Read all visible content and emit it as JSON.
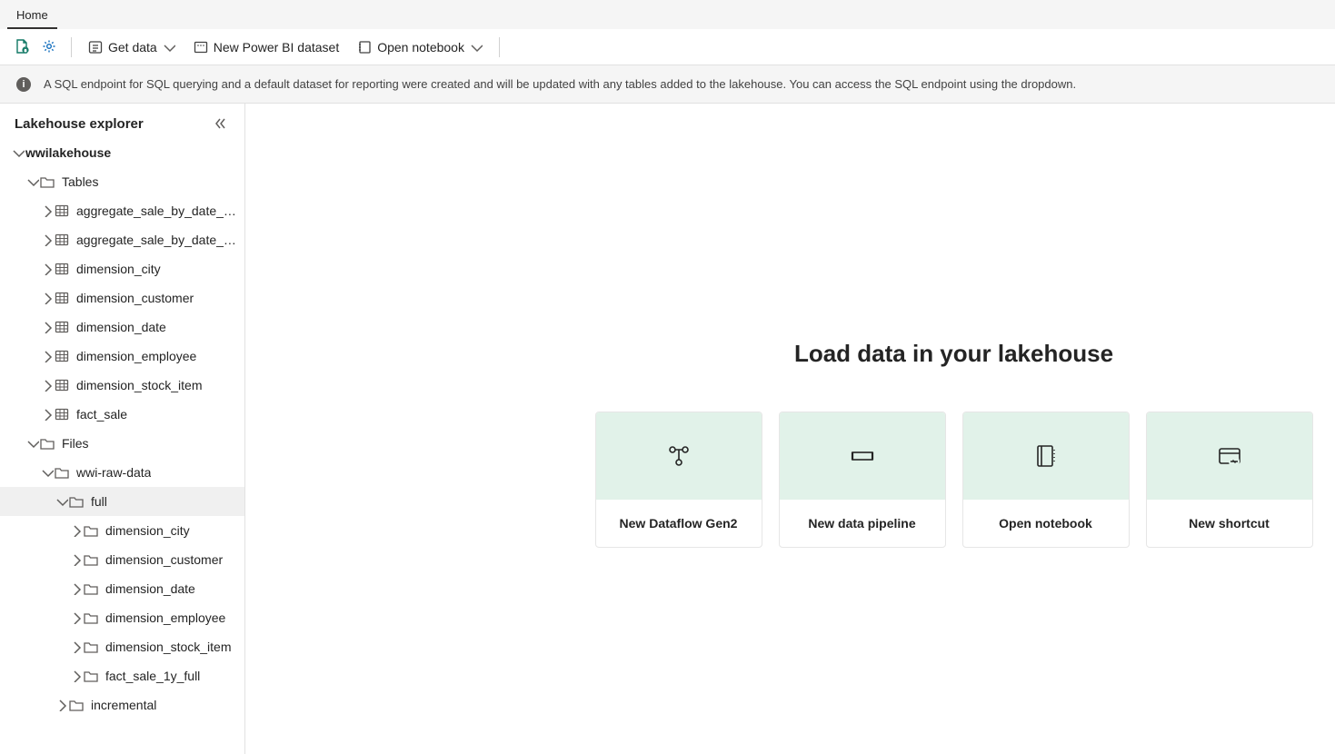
{
  "tabs": {
    "home": "Home"
  },
  "toolbar": {
    "get_data": "Get data",
    "new_dataset": "New Power BI dataset",
    "open_notebook": "Open notebook"
  },
  "infobar": {
    "text": "A SQL endpoint for SQL querying and a default dataset for reporting were created and will be updated with any tables added to the lakehouse. You can access the SQL endpoint using the dropdown."
  },
  "sidebar": {
    "title": "Lakehouse explorer",
    "root": "wwilakehouse",
    "tables_label": "Tables",
    "files_label": "Files",
    "tables": [
      "aggregate_sale_by_date_city",
      "aggregate_sale_by_date_em",
      "dimension_city",
      "dimension_customer",
      "dimension_date",
      "dimension_employee",
      "dimension_stock_item",
      "fact_sale"
    ],
    "files_root": "wwi-raw-data",
    "files_full": "full",
    "files_full_children": [
      "dimension_city",
      "dimension_customer",
      "dimension_date",
      "dimension_employee",
      "dimension_stock_item",
      "fact_sale_1y_full"
    ],
    "files_incremental": "incremental"
  },
  "content": {
    "title": "Load data in your lakehouse",
    "cards": [
      "New Dataflow Gen2",
      "New data pipeline",
      "Open notebook",
      "New shortcut"
    ]
  }
}
